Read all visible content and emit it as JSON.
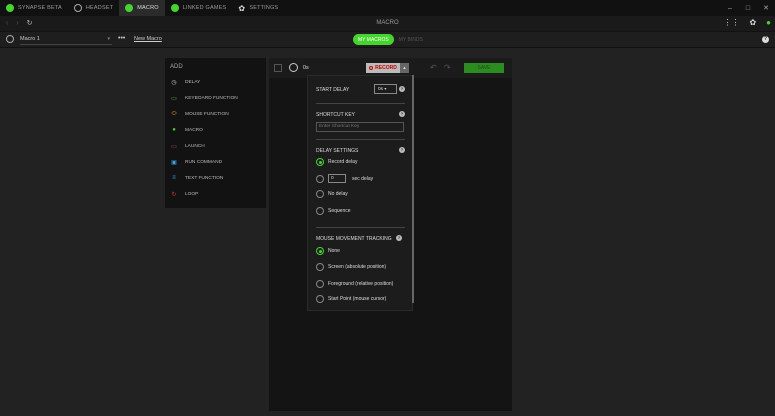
{
  "titlebar": {
    "tabs": [
      {
        "label": "SYNAPSE BETA"
      },
      {
        "label": "HEADSET"
      },
      {
        "label": "MACRO"
      },
      {
        "label": "LINKED GAMES"
      },
      {
        "label": "SETTINGS"
      }
    ],
    "minimize": "–",
    "maximize": "□",
    "close": "✕"
  },
  "navbar": {
    "back": "‹",
    "forward": "›",
    "refresh": "↻",
    "title": "MACRO"
  },
  "subbar": {
    "macro_select": "Macro 1",
    "more": "•••",
    "new_macro": "New Macro",
    "tabs": [
      "MY MACROS",
      "MY BINDS"
    ]
  },
  "add_panel": {
    "header": "ADD",
    "items": [
      {
        "label": "DELAY",
        "icon": "clock-icon",
        "color": "#cccccc"
      },
      {
        "label": "KEYBOARD FUNCTION",
        "icon": "keyboard-icon",
        "color": "#44d62c"
      },
      {
        "label": "MOUSE FUNCTION",
        "icon": "mouse-icon",
        "color": "#f0a020"
      },
      {
        "label": "MACRO",
        "icon": "macro-icon",
        "color": "#44d62c"
      },
      {
        "label": "LAUNCH",
        "icon": "folder-icon",
        "color": "#d040a0"
      },
      {
        "label": "RUN COMMAND",
        "icon": "terminal-icon",
        "color": "#40a0e0"
      },
      {
        "label": "TEXT FUNCTION",
        "icon": "text-icon",
        "color": "#40a0e0"
      },
      {
        "label": "LOOP",
        "icon": "loop-icon",
        "color": "#e03030"
      }
    ]
  },
  "editor": {
    "time": "0s",
    "record_label": "RECORD",
    "save_label": "SAVE"
  },
  "record_menu": {
    "start_delay_label": "START DELAY",
    "start_delay_value": "0s",
    "shortcut_label": "SHORTCUT KEY",
    "shortcut_placeholder": "Enter Shortcut Key",
    "delay_settings_label": "DELAY SETTINGS",
    "delay_options": {
      "record": "Record delay",
      "sec_value": "0",
      "sec_label": "sec delay",
      "none": "No delay",
      "sequence": "Sequence"
    },
    "mouse_tracking_label": "MOUSE MOVEMENT TRACKING",
    "mouse_options": [
      "None",
      "Screen (absolute position)",
      "Foreground (relative position)",
      "Start Point (mouse cursor)"
    ]
  },
  "colors": {
    "accent": "#44d62c",
    "record": "#cc0000"
  }
}
